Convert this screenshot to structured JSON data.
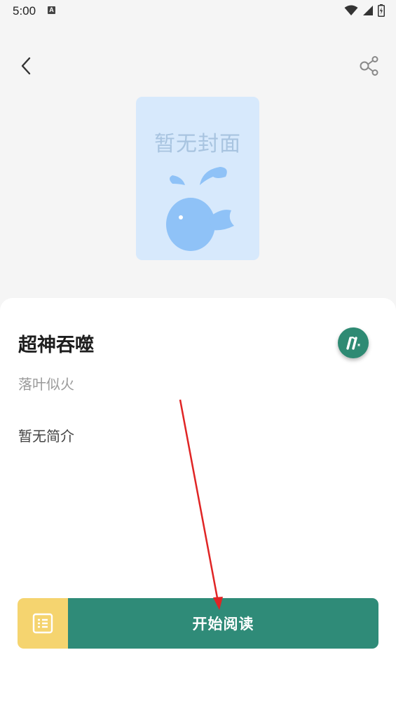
{
  "status_bar": {
    "time": "5:00",
    "icons": [
      "text-input-icon",
      "wifi-icon",
      "signal-icon",
      "battery-charging-icon"
    ]
  },
  "header": {
    "back_icon": "chevron-left-icon",
    "share_icon": "share-icon"
  },
  "cover": {
    "placeholder_text": "暂无封面",
    "illustration": "whale-icon",
    "background_color": "#d7e9fc",
    "accent_color": "#8fc2f7"
  },
  "book": {
    "title": "超神吞噬",
    "author": "落叶似火",
    "intro": "暂无简介"
  },
  "fab": {
    "icon": "theme-switch-icon",
    "color": "#2e8a73"
  },
  "bottom_bar": {
    "catalog_icon": "list-icon",
    "catalog_color": "#f5d46f",
    "start_reading_label": "开始阅读",
    "start_reading_color": "#2f8b78"
  },
  "annotation": {
    "arrow_color": "#e02525"
  }
}
